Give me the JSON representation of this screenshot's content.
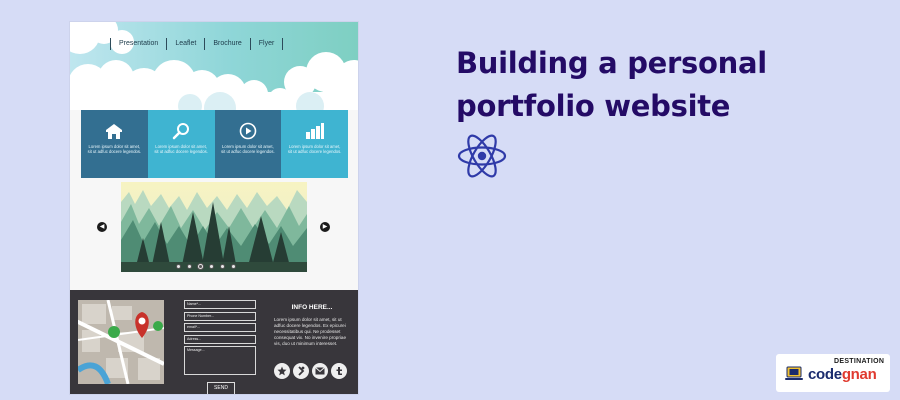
{
  "mockup": {
    "nav": [
      "Presentation",
      "Leaflet",
      "Brochure",
      "Flyer"
    ],
    "tiles": [
      {
        "icon": "home-icon",
        "color": "#336f91",
        "text": "Lorem ipsum dolor sit amet, sit ut adfuc docere legendos."
      },
      {
        "icon": "search-icon",
        "color": "#3fb4d1",
        "text": "Lorem ipsum dolor sit amet, sit ut adfuc docere legendos."
      },
      {
        "icon": "play-icon",
        "color": "#336f91",
        "text": "Lorem ipsum dolor sit amet, sit ut adfuc docere legendos."
      },
      {
        "icon": "bar-chart-icon",
        "color": "#3fb4d1",
        "text": "Lorem ipsum dolor sit amet, sit ut adfuc docere legendos."
      }
    ],
    "slider": {
      "dot_count": 6,
      "active_dot": 3
    },
    "form": {
      "fields": [
        "Name*...",
        "Phone Number...",
        "email*...",
        "Adress...",
        "Message..."
      ],
      "send_label": "SEND"
    },
    "info": {
      "title": "INFO HERE...",
      "text": "Lorem ipsum dolor sit amet, sit ut adfuc docere legendos. Ex epicurei necessitatibus qui. Ne prodesset consequat vix. No invenire propriae vis, duo ut minimum interesset."
    },
    "social_icons": [
      "pinterest-icon",
      "skype-icon",
      "mail-icon",
      "tumblr-icon"
    ]
  },
  "headline": "Building a personal portfolio website",
  "brand": {
    "top": "DESTINATION",
    "name_part1": "code",
    "name_part2": "gnan"
  },
  "colors": {
    "background": "#d6dcf6",
    "headline": "#240b66",
    "react_logo": "#2f3aa8",
    "footer": "#38363b"
  }
}
